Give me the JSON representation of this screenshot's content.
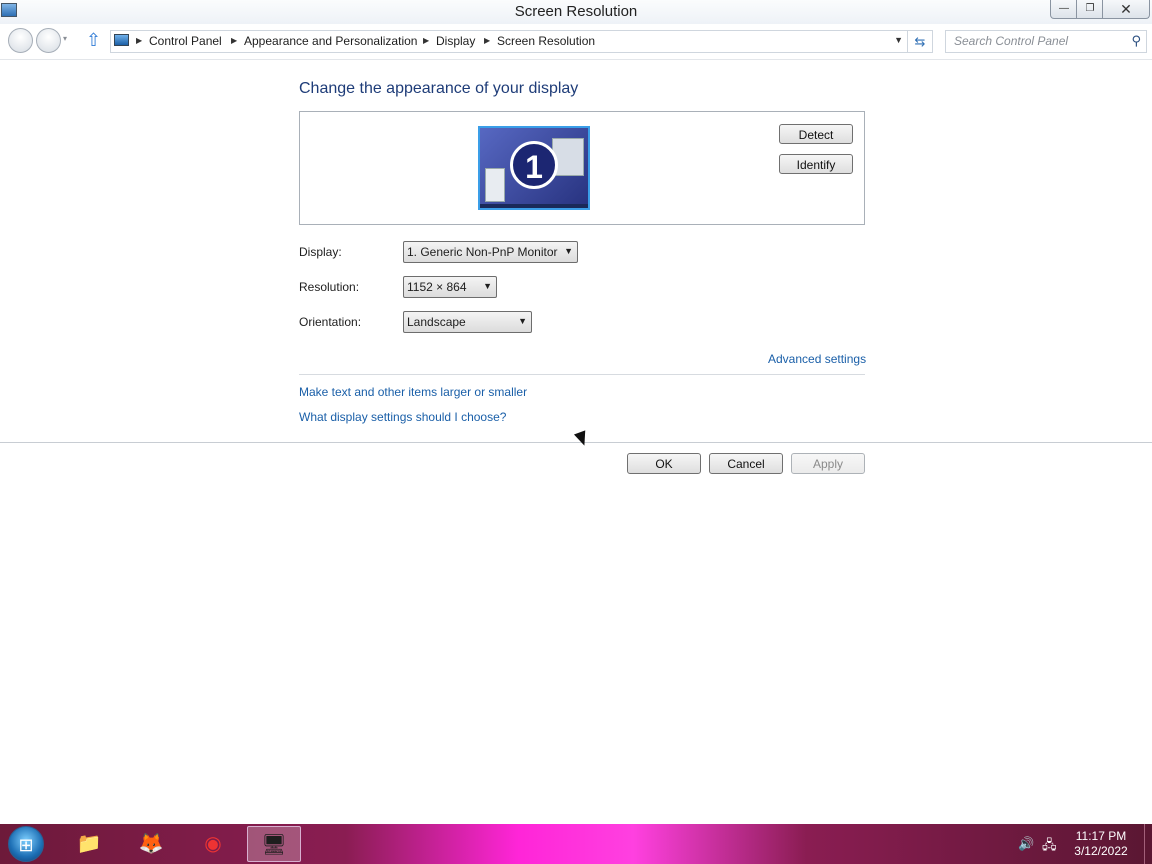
{
  "window": {
    "title": "Screen Resolution",
    "minimize": "—",
    "maximize": "❐",
    "close": "✕"
  },
  "nav": {
    "back": "",
    "forward": "",
    "recent": "▾",
    "up": "⇧",
    "breadcrumbs": [
      "Control Panel",
      "Appearance and Personalization",
      "Display",
      "Screen Resolution"
    ],
    "dropdown": "▼",
    "refresh": "⇆",
    "search_placeholder": "Search Control Panel",
    "search_icon": "⚲"
  },
  "main": {
    "heading": "Change the appearance of your display",
    "monitor_number": "1",
    "detect_label": "Detect",
    "identify_label": "Identify",
    "display_label": "Display:",
    "display_value": "1. Generic Non-PnP Monitor",
    "resolution_label": "Resolution:",
    "resolution_value": "1152 × 864",
    "orientation_label": "Orientation:",
    "orientation_value": "Landscape",
    "advanced_link": "Advanced settings",
    "link_text_size": "Make text and other items larger or smaller",
    "link_settings_help": "What display settings should I choose?",
    "ok_label": "OK",
    "cancel_label": "Cancel",
    "apply_label": "Apply"
  },
  "taskbar": {
    "start_icon": "windows-logo-icon",
    "items": [
      {
        "name": "file-explorer",
        "glyph": "📁"
      },
      {
        "name": "firefox",
        "glyph": "🦊"
      },
      {
        "name": "chrome",
        "glyph": "◉"
      },
      {
        "name": "control-panel",
        "glyph": "🖥"
      }
    ],
    "tray_volume": "🔊",
    "tray_network": "🖧",
    "time": "11:17 PM",
    "date": "3/12/2022"
  },
  "colors": {
    "link": "#1a5fa8",
    "heading": "#1e3c78",
    "taskbar_accent": "#ff25d8"
  }
}
